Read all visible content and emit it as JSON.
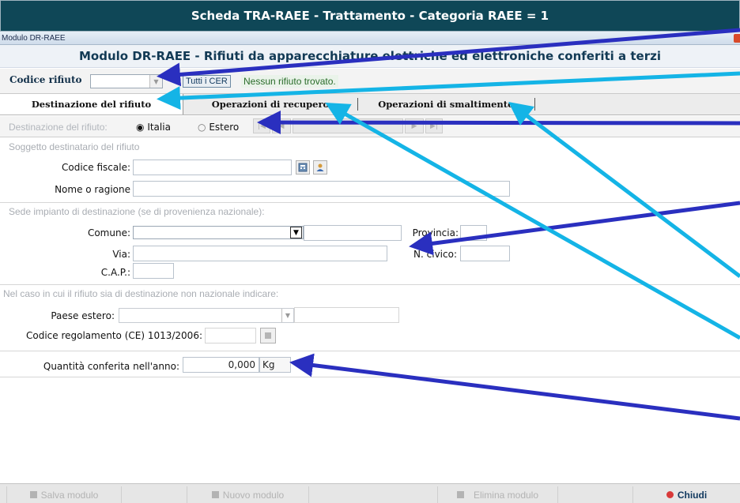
{
  "app": {
    "title": "Scheda TRA-RAEE - Trattamento - Categoria RAEE = 1",
    "window_title": "Modulo DR-RAEE",
    "module_heading": "Modulo DR-RAEE - Rifiuti da apparecchiature elettriche ed elettroniche conferiti a terzi"
  },
  "cer": {
    "label": "Codice rifiuto",
    "value": "",
    "tutti_button": "Tutti i CER",
    "message": "Nessun rifiuto trovato."
  },
  "tabs": [
    {
      "label": "Destinazione del rifiuto",
      "active": true
    },
    {
      "label": "Operazioni di recupero",
      "active": false
    },
    {
      "label": "Operazioni di smaltimento",
      "active": false
    }
  ],
  "destination": {
    "label": "Destinazione del rifiuto:",
    "options": [
      "Italia",
      "Estero"
    ],
    "selected": "Italia"
  },
  "soggetto": {
    "section_title": "Soggetto destinatario del rifiuto",
    "codice_fiscale_label": "Codice fiscale:",
    "codice_fiscale_value": "",
    "nome_label": "Nome o ragione",
    "nome_value": ""
  },
  "sede": {
    "section_title": "Sede impianto di destinazione (se di provenienza nazionale):",
    "comune_label": "Comune:",
    "provincia_label": "Provincia:",
    "via_label": "Via:",
    "civico_label": "N. civico:",
    "cap_label": "C.A.P.:"
  },
  "estero": {
    "section_title": "Nel caso in cui il rifiuto sia di destinazione non nazionale indicare:",
    "paese_label": "Paese estero:",
    "codice_reg_label": "Codice regolamento (CE) 1013/2006:"
  },
  "quantita": {
    "label": "Quantità conferita nell'anno:",
    "value": "0,000",
    "unit": "Kg"
  },
  "footer": {
    "salva": "Salva modulo",
    "nuovo": "Nuovo modulo",
    "elimina": "Elimina modulo",
    "chiudi": "Chiudi"
  },
  "colors": {
    "title_bg": "#0f4757",
    "arrow_dark": "#2a2fbf",
    "arrow_light": "#14b4e6",
    "close_icon": "#d83a3a"
  }
}
